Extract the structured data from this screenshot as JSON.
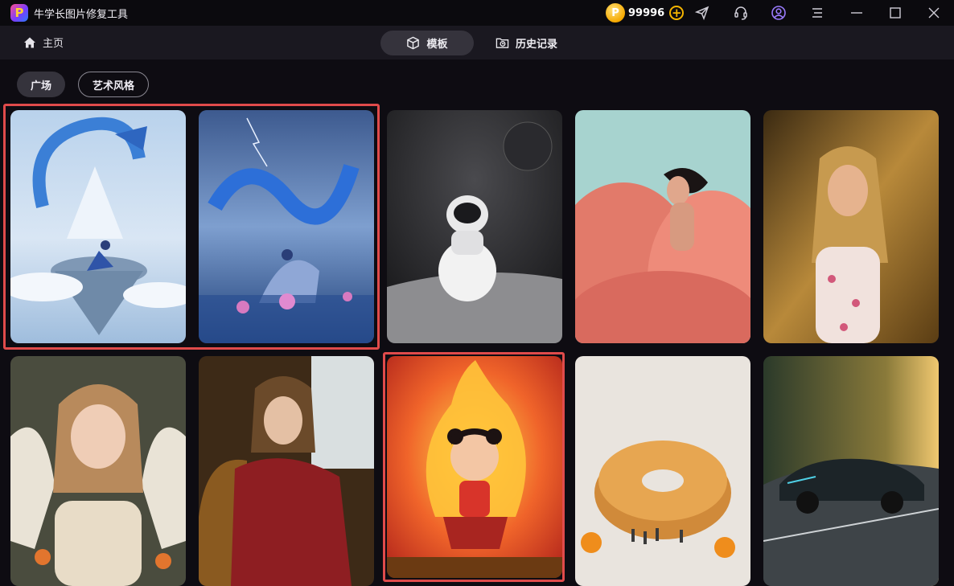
{
  "app": {
    "title": "牛学长图片修复工具",
    "logo_letter": "P",
    "coin_symbol": "P",
    "coin_count": "99996",
    "coin_add": "+"
  },
  "titlebar_icons": [
    "send-icon",
    "headset-icon",
    "user-icon",
    "menu-icon",
    "minimize-icon",
    "maximize-icon",
    "close-icon"
  ],
  "nav": {
    "home_label": "主页",
    "tabs": [
      {
        "label": "模板",
        "icon": "cube-icon",
        "active": true
      },
      {
        "label": "历史记录",
        "icon": "history-folder-icon",
        "active": false
      }
    ]
  },
  "filters": [
    {
      "label": "广场",
      "active": true
    },
    {
      "label": "艺术风格",
      "active": false
    }
  ],
  "gallery": [
    {
      "subject": "dragon-mountain",
      "highlighted": true
    },
    {
      "subject": "dragon-lotus",
      "highlighted": true
    },
    {
      "subject": "astronaut-egg",
      "highlighted": false
    },
    {
      "subject": "woman-pink-feathers",
      "highlighted": false
    },
    {
      "subject": "girl-wheat-field",
      "highlighted": false
    },
    {
      "subject": "angel-girl",
      "highlighted": false
    },
    {
      "subject": "victorian-lady",
      "highlighted": false
    },
    {
      "subject": "fire-child",
      "highlighted": true
    },
    {
      "subject": "bagel-miniatures",
      "highlighted": false
    },
    {
      "subject": "sports-car",
      "highlighted": false
    }
  ],
  "colors": {
    "background": "#0e0c12",
    "titlebar": "#0b0a0e",
    "navbar": "#1a1820",
    "active_pill": "#35333c",
    "highlight": "#e04b4b",
    "coin": "#f5b400"
  }
}
